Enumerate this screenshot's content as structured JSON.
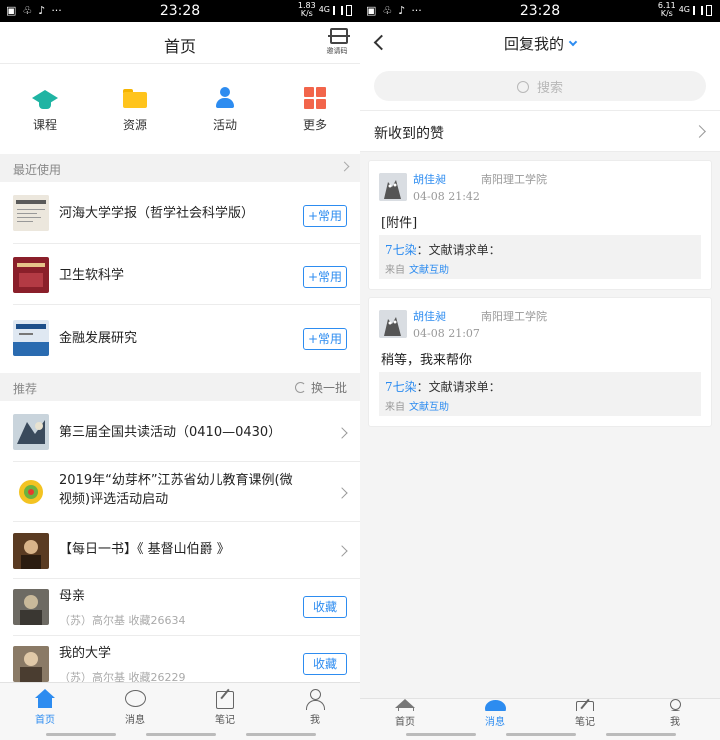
{
  "status_left": {
    "time": "23:28",
    "speed_value": "1.83",
    "speed_unit": "K/s",
    "network": "4G"
  },
  "status_right": {
    "time": "23:28",
    "speed_value": "6.11",
    "speed_unit": "K/s",
    "network": "4G"
  },
  "home": {
    "title": "首页",
    "scan_label": "邀请码",
    "grid": [
      {
        "label": "课程",
        "icon": "graduation-cap-icon",
        "color": "#1fb4a3"
      },
      {
        "label": "资源",
        "icon": "folder-icon",
        "color": "#ffc41c"
      },
      {
        "label": "活动",
        "icon": "people-icon",
        "color": "#2d8cf0"
      },
      {
        "label": "更多",
        "icon": "grid-icon",
        "color": "#f2654b"
      }
    ],
    "recent": {
      "header": "最近使用",
      "items": [
        {
          "title": "河海大学学报（哲学社会科学版）",
          "button": "+常用"
        },
        {
          "title": "卫生软科学",
          "button": "+常用"
        },
        {
          "title": "金融发展研究",
          "button": "+常用"
        }
      ]
    },
    "recommend": {
      "header": "推荐",
      "refresh": "换一批",
      "items": [
        {
          "title": "第三届全国共读活动（0410—0430）"
        },
        {
          "title": "2019年“幼芽杯”江苏省幼儿教育课例(微视频)评选活动启动"
        },
        {
          "title": "【每日一书】《 基督山伯爵 》"
        },
        {
          "title": "母亲",
          "sub": "（苏）高尔基 收藏26634",
          "button": "收藏"
        },
        {
          "title": "我的大学",
          "sub": "（苏）高尔基 收藏26229",
          "button": "收藏"
        }
      ]
    }
  },
  "tabs": [
    {
      "label": "首页",
      "icon": "home-icon"
    },
    {
      "label": "消息",
      "icon": "message-icon"
    },
    {
      "label": "笔记",
      "icon": "note-icon"
    },
    {
      "label": "我",
      "icon": "profile-icon"
    }
  ],
  "replies": {
    "title": "回复我的",
    "search_placeholder": "搜索",
    "likes_label": "新收到的赞",
    "items": [
      {
        "name": "胡佳昶",
        "school": "南阳理工学院",
        "time": "04-08 21:42",
        "content": "[附件]",
        "quote_name": "7七染",
        "quote_text": "：文献请求单：",
        "from_label": "来自",
        "from_link": "文献互助"
      },
      {
        "name": "胡佳昶",
        "school": "南阳理工学院",
        "time": "04-08 21:07",
        "content": "稍等，我来帮你",
        "quote_name": "7七染",
        "quote_text": "：文献请求单：",
        "from_label": "来自",
        "from_link": "文献互助"
      }
    ]
  },
  "colors": {
    "accent": "#2d8cf0",
    "section_bg": "#f2f2f2"
  }
}
